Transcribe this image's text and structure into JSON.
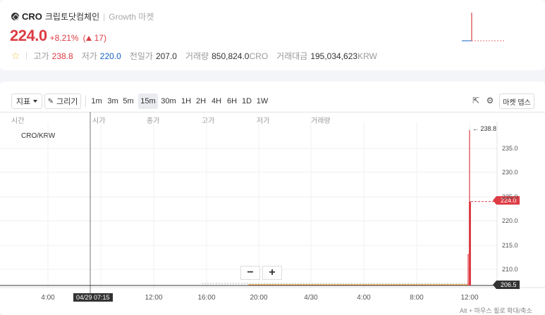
{
  "header": {
    "symbol": "CRO",
    "korean_name": "크립토닷컴체인",
    "market": "Growth 마켓",
    "price": "224.0",
    "change_pct": "+8.21%",
    "change_abs": "17"
  },
  "stats": {
    "high_label": "고가",
    "high": "238.8",
    "low_label": "저가",
    "low": "220.0",
    "prev_label": "전일가",
    "prev": "207.0",
    "volume_label": "거래량",
    "volume": "850,824.0",
    "volume_unit": "CRO",
    "amount_label": "거래대금",
    "amount": "195,034,623",
    "amount_unit": "KRW"
  },
  "toolbar": {
    "indicator_label": "지표",
    "draw_label": "그리기",
    "intervals": [
      "1m",
      "3m",
      "5m",
      "15m",
      "30m",
      "1H",
      "2H",
      "4H",
      "6H",
      "1D",
      "1W"
    ],
    "active_interval": "15m",
    "market_depth_label": "마켓 뎁스"
  },
  "chart_header": {
    "labels": [
      "시간",
      "시가",
      "종가",
      "고가",
      "저가",
      "거래량"
    ],
    "pair": "CRO/KRW"
  },
  "chart_data": {
    "type": "line",
    "y_ticks": [
      "235.0",
      "230.0",
      "225.0",
      "220.0",
      "215.0",
      "210.0"
    ],
    "x_ticks": [
      "4:00",
      "8:00",
      "12:00",
      "16:00",
      "20:00",
      "4/30",
      "4:00",
      "8:00",
      "12:00"
    ],
    "high_marker": "← 238.8",
    "current_price_tag": "224.0",
    "low_price_tag": "206.5",
    "crosshair_time": "04/29 07:15",
    "flat_value": 207.0,
    "spike_high": 238.8,
    "spike_close": 224.0
  },
  "colors": {
    "up": "#dd3c44",
    "down": "#1261c4",
    "active_bg": "#e9ebef"
  },
  "hint": "Alt + 마우스 휠로 확대/축소"
}
